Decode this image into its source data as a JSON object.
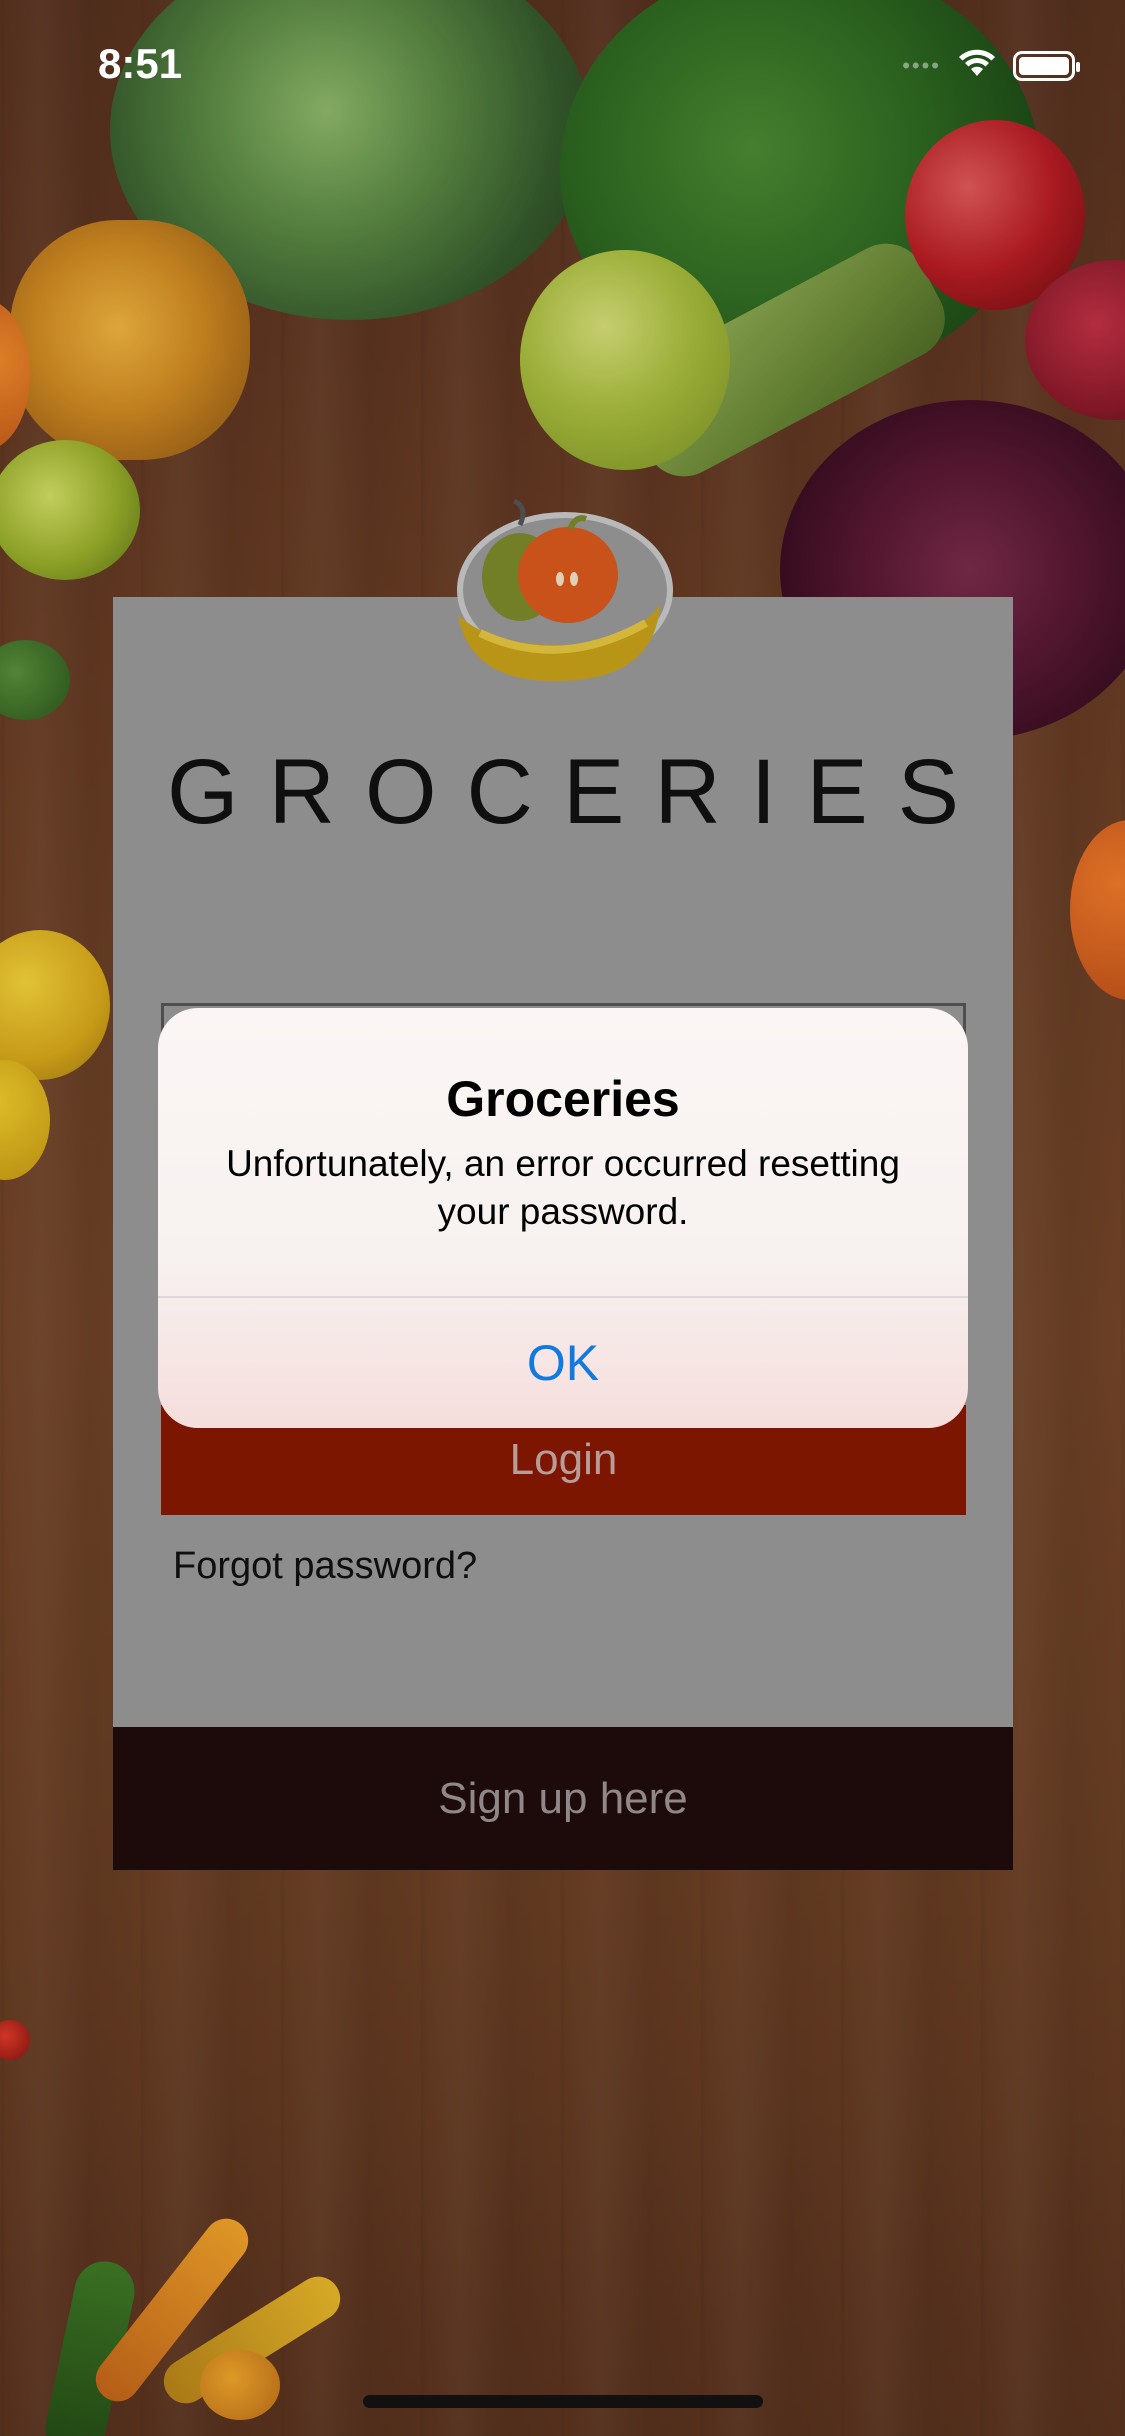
{
  "status_bar": {
    "time": "8:51",
    "signal_icon": "cellular-signal-icon",
    "wifi_icon": "wifi-icon",
    "battery_icon": "battery-icon"
  },
  "app": {
    "logo_icon": "fruit-basket-logo-icon",
    "title": "GROCERIES"
  },
  "login_form": {
    "login_label": "Login",
    "forgot_password": "Forgot password?",
    "signup_label": "Sign up here"
  },
  "alert": {
    "title": "Groceries",
    "message": "Unfortunately, an error occurred resetting your password.",
    "ok_label": "OK"
  },
  "colors": {
    "login_button": "#871800",
    "signup_bar": "#200b0d",
    "card": "#999999",
    "alert_action": "#1279e0"
  }
}
